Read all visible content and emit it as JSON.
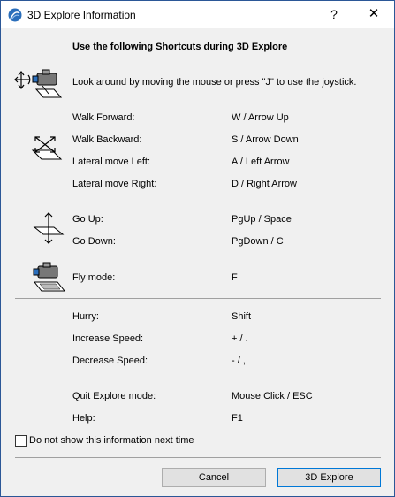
{
  "window": {
    "title": "3D Explore Information",
    "help_glyph": "?",
    "close_glyph": "✕"
  },
  "heading": "Use the following Shortcuts during 3D Explore",
  "look_around": "Look around by moving the mouse or press \"J\" to use the joystick.",
  "movement": [
    {
      "label": "Walk Forward:",
      "key": "W / Arrow Up"
    },
    {
      "label": "Walk Backward:",
      "key": "S / Arrow Down"
    },
    {
      "label": "Lateral move Left:",
      "key": "A / Left Arrow"
    },
    {
      "label": "Lateral move Right:",
      "key": "D / Right Arrow"
    }
  ],
  "vertical": [
    {
      "label": "Go Up:",
      "key": "PgUp / Space"
    },
    {
      "label": "Go Down:",
      "key": "PgDown / C"
    }
  ],
  "fly": {
    "label": "Fly mode:",
    "key": "F"
  },
  "speed": [
    {
      "label": "Hurry:",
      "key": "Shift"
    },
    {
      "label": "Increase Speed:",
      "key": "+ / ."
    },
    {
      "label": "Decrease Speed:",
      "key": "- / ,"
    }
  ],
  "misc": [
    {
      "label": "Quit Explore mode:",
      "key": "Mouse Click / ESC"
    },
    {
      "label": "Help:",
      "key": "F1"
    }
  ],
  "checkbox_label": "Do not show this information next time",
  "buttons": {
    "cancel": "Cancel",
    "explore": "3D Explore"
  },
  "colors": {
    "accent": "#0078d7",
    "window_border": "#2b5797",
    "icon_blue": "#2a6ebb"
  }
}
